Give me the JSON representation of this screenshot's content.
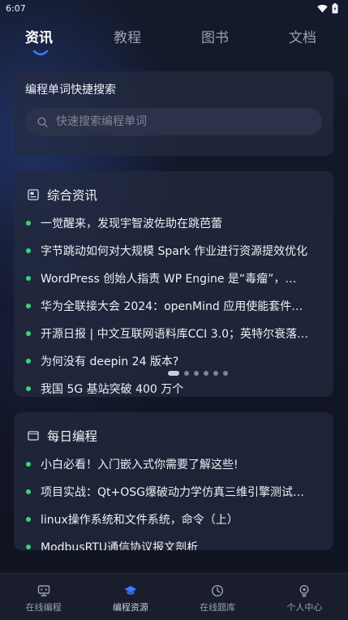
{
  "status_bar": {
    "time": "6:07"
  },
  "top_tabs": [
    {
      "label": "资讯",
      "active": true
    },
    {
      "label": "教程",
      "active": false
    },
    {
      "label": "图书",
      "active": false
    },
    {
      "label": "文档",
      "active": false
    }
  ],
  "search_card": {
    "title": "编程单词快捷搜索",
    "placeholder": "快速搜索编程单词"
  },
  "news_card": {
    "title": "综合资讯",
    "items": [
      "一觉醒来，发现宇智波佐助在跳芭蕾",
      "字节跳动如何对大规模 Spark 作业进行资源提效优化",
      "WordPress 创始人指责 WP Engine 是“毒瘤”，…",
      "华为全联接大会 2024：openMind 应用使能套件…",
      "开源日报 | 中文互联网语料库CCI 3.0；英特尔衰落…",
      "为何没有 deepin 24 版本?",
      "我国 5G 基站突破 400 万个"
    ],
    "pager_count": 6,
    "pager_active": 0
  },
  "daily_card": {
    "title": "每日编程",
    "items": [
      "小白必看！入门嵌入式你需要了解这些!",
      "项目实战：Qt+OSG爆破动力学仿真三维引擎测试…",
      "linux操作系统和文件系统，命令（上）",
      "ModbusRTU通信协议报文剖析"
    ]
  },
  "bottom_nav": [
    {
      "label": "在线编程",
      "icon": "monitor-icon",
      "active": false
    },
    {
      "label": "编程资源",
      "icon": "graduation-cap-icon",
      "active": true
    },
    {
      "label": "在线题库",
      "icon": "pie-clock-icon",
      "active": false
    },
    {
      "label": "个人中心",
      "icon": "user-bulb-icon",
      "active": false
    }
  ],
  "colors": {
    "accent": "#3a7bff",
    "bullet": "#37d67a",
    "background": "#111523",
    "card": "#242b40"
  }
}
